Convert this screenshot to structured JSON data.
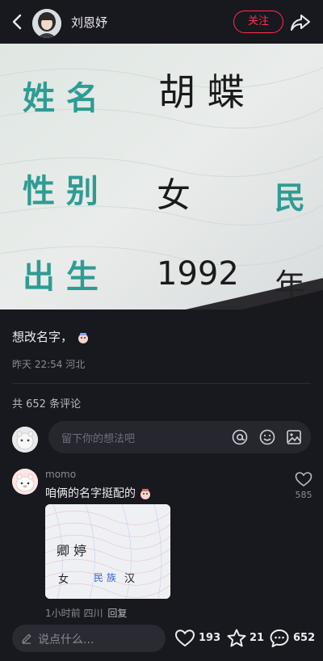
{
  "header": {
    "author_name": "刘恩妤",
    "follow_label": "关注",
    "back_icon": "chevron-left-icon",
    "share_icon": "share-arrow-icon"
  },
  "photo": {
    "field_labels": [
      "姓 名",
      "性 别",
      "出 生"
    ],
    "name_value": "胡 蝶",
    "gender_value": "女",
    "ethnicity_label": "民",
    "birth_year": "1992",
    "year_char": "年"
  },
  "post": {
    "caption": "想改名字，",
    "time": "昨天 22:54",
    "location": "河北",
    "comment_count_text": "共 652 条评论"
  },
  "comment_input": {
    "placeholder": "留下你的想法吧",
    "icons": [
      "at-icon",
      "emoji-icon",
      "image-icon"
    ]
  },
  "comment": {
    "username": "momo",
    "text": "咱俩的名字挺配的",
    "likes": "585",
    "time": "1小时前",
    "location": "四川",
    "reply_label": "回复",
    "image": {
      "name_value": "卿 婷",
      "gender_value": "女",
      "ethnicity_label": "民 族",
      "ethnicity_value": "汉"
    }
  },
  "bottom_bar": {
    "input_placeholder": "说点什么...",
    "like_count": "193",
    "star_count": "21",
    "comment_count": "652"
  },
  "colors": {
    "background": "#18181f",
    "accent_red": "#ff2e4d",
    "id_label_teal": "#2f9c93"
  }
}
